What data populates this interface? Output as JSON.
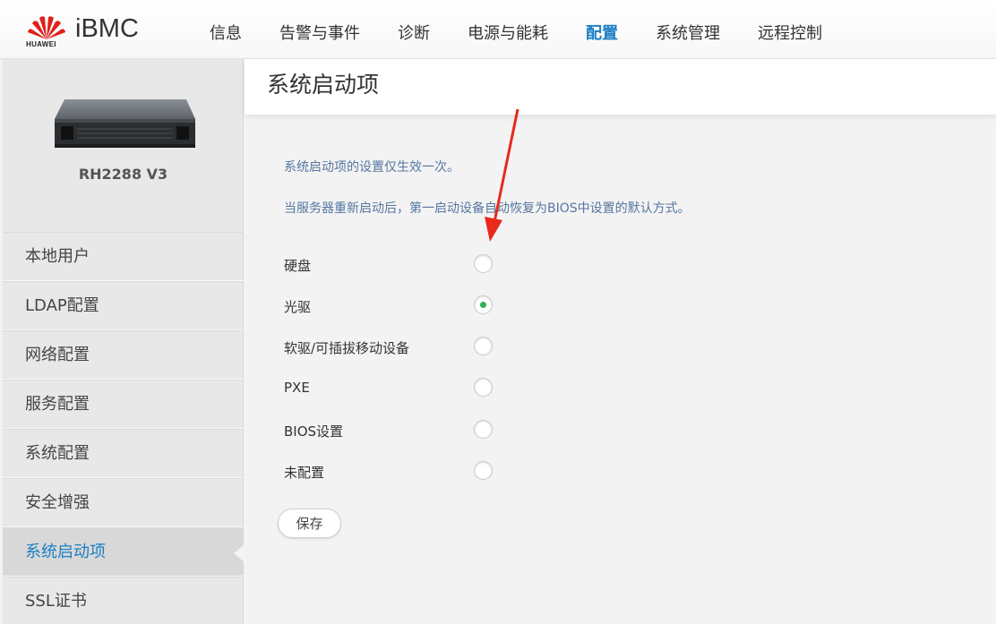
{
  "header": {
    "brand_text": "HUAWEI",
    "product_name": "iBMC",
    "nav": [
      {
        "label": "信息",
        "active": false
      },
      {
        "label": "告警与事件",
        "active": false
      },
      {
        "label": "诊断",
        "active": false
      },
      {
        "label": "电源与能耗",
        "active": false
      },
      {
        "label": "配置",
        "active": true
      },
      {
        "label": "系统管理",
        "active": false
      },
      {
        "label": "远程控制",
        "active": false
      }
    ]
  },
  "sidebar": {
    "server_model": "RH2288 V3",
    "items": [
      {
        "label": "本地用户",
        "active": false
      },
      {
        "label": "LDAP配置",
        "active": false
      },
      {
        "label": "网络配置",
        "active": false
      },
      {
        "label": "服务配置",
        "active": false
      },
      {
        "label": "系统配置",
        "active": false
      },
      {
        "label": "安全增强",
        "active": false
      },
      {
        "label": "系统启动项",
        "active": true
      },
      {
        "label": "SSL证书",
        "active": false
      }
    ]
  },
  "main": {
    "title": "系统启动项",
    "note1": "系统启动项的设置仅生效一次。",
    "note2": "当服务器重新启动后，第一启动设备自动恢复为BIOS中设置的默认方式。",
    "options": [
      {
        "label": "硬盘",
        "selected": false
      },
      {
        "label": "光驱",
        "selected": true
      },
      {
        "label": "软驱/可插拔移动设备",
        "selected": false
      },
      {
        "label": "PXE",
        "selected": false
      },
      {
        "label": "BIOS设置",
        "selected": false
      },
      {
        "label": "未配置",
        "selected": false
      }
    ],
    "save_label": "保存"
  },
  "colors": {
    "accent": "#1c7ec5",
    "radio_selected": "#2fae55",
    "annotation_arrow": "#e8291c",
    "note_text": "#5577a0"
  }
}
